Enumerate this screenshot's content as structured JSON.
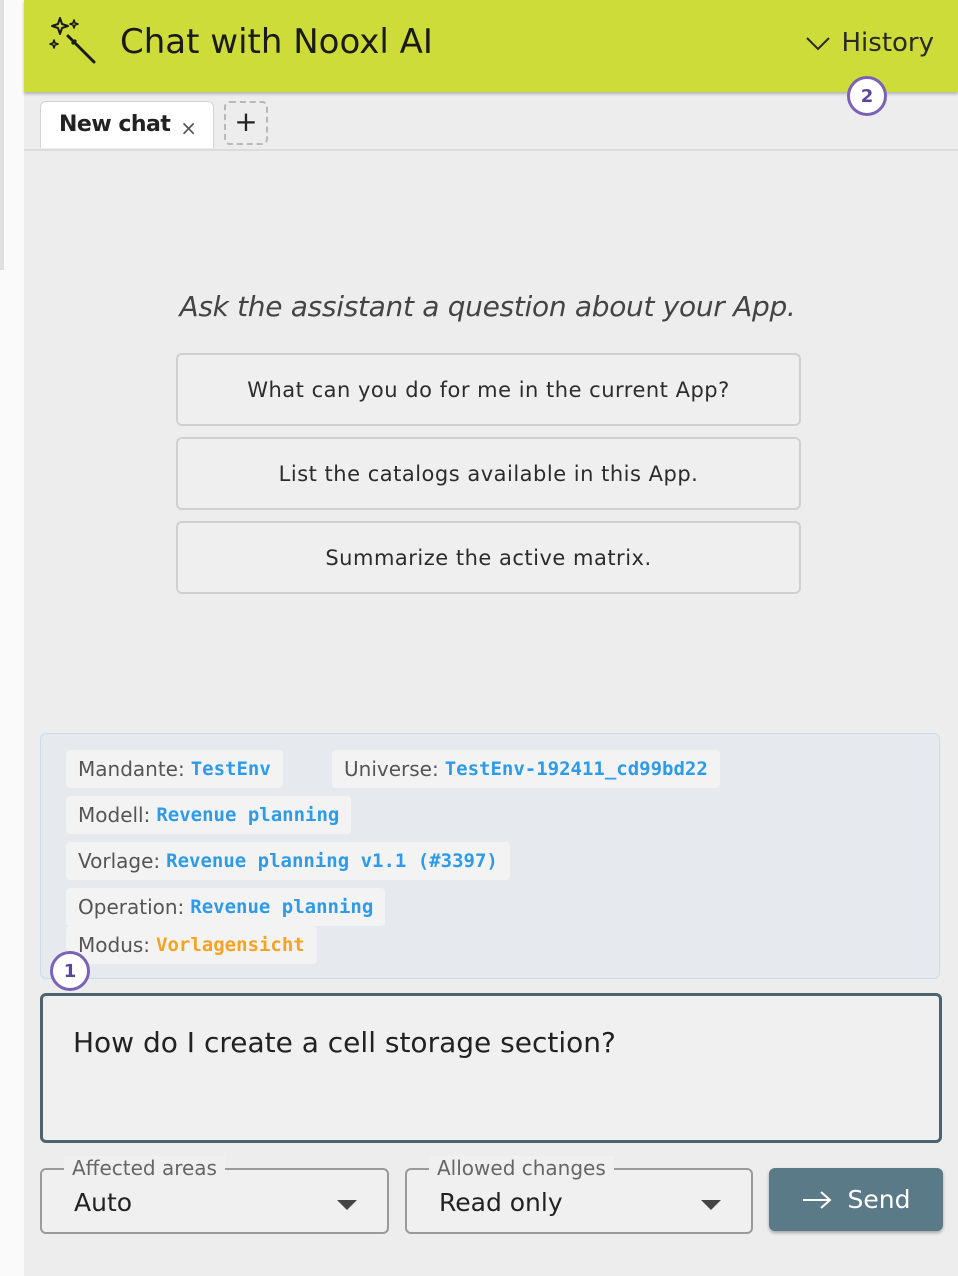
{
  "header": {
    "title": "Chat with Nooxl AI",
    "history_label": "History",
    "accent_color": "#cddc39"
  },
  "annotations": [
    "1",
    "2"
  ],
  "tabs": [
    {
      "label": "New chat",
      "close": "×"
    }
  ],
  "add_tab_label": "+",
  "main": {
    "prompt": "Ask the assistant a question about your App.",
    "suggestions": [
      "What can you do for me in the current App?",
      "List the catalogs available in this App.",
      "Summarize the active matrix."
    ]
  },
  "context": {
    "mandante": {
      "key": "Mandante:",
      "value": "TestEnv"
    },
    "universe": {
      "key": "Universe:",
      "value": "TestEnv-192411_cd99bd22"
    },
    "modell": {
      "key": "Modell:",
      "value": "Revenue planning"
    },
    "vorlage": {
      "key": "Vorlage:",
      "value": "Revenue planning v1.1 (#3397)"
    },
    "operation": {
      "key": "Operation:",
      "value": "Revenue planning"
    },
    "modus": {
      "key": "Modus:",
      "value": "Vorlagensicht"
    }
  },
  "composer": {
    "input_value": "How do I create a cell storage section?",
    "affected_areas": {
      "label": "Affected areas",
      "value": "Auto"
    },
    "allowed_changes": {
      "label": "Allowed changes",
      "value": "Read only"
    },
    "send_label": "Send"
  },
  "icons": {
    "wand": "magic-wand-icon",
    "history": "chevron-down-icon",
    "send": "arrow-right-icon",
    "dropdown": "caret-down-icon"
  }
}
